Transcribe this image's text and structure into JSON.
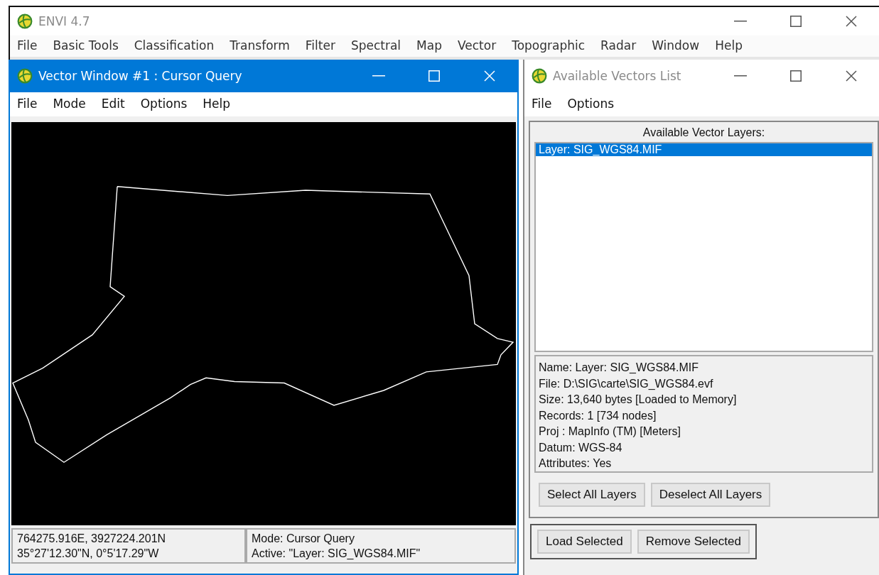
{
  "main_window": {
    "title": "ENVI 4.7",
    "active": false,
    "menu": [
      "File",
      "Basic Tools",
      "Classification",
      "Transform",
      "Filter",
      "Spectral",
      "Map",
      "Vector",
      "Topographic",
      "Radar",
      "Window",
      "Help"
    ]
  },
  "vector_window": {
    "title": "Vector Window #1 : Cursor Query",
    "active": true,
    "menu": [
      "File",
      "Mode",
      "Edit",
      "Options",
      "Help"
    ],
    "status": {
      "coordinates": [
        "764275.916E, 3927224.201N",
        "35°27'12.30\"N, 0°5'17.29\"W"
      ],
      "mode": [
        "Mode: Cursor Query",
        "Active: \"Layer: SIG_WGS84.MIF\""
      ]
    }
  },
  "vectors_list": {
    "title": "Available Vectors List",
    "active": false,
    "menu": [
      "File",
      "Options"
    ],
    "list_label": "Available Vector Layers:",
    "layers": [
      {
        "label": "Layer: SIG_WGS84.MIF",
        "selected": true
      }
    ],
    "info": [
      "Name: Layer: SIG_WGS84.MIF",
      "File: D:\\SIG\\carte\\SIG_WGS84.evf",
      "Size: 13,640 bytes [Loaded to Memory]",
      "Records: 1 [734 nodes]",
      "Proj : MapInfo (TM) [Meters]",
      "Datum: WGS-84",
      "Attributes: Yes"
    ],
    "layer_buttons": [
      "Select All Layers",
      "Deselect All Layers"
    ],
    "bottom_buttons": [
      "Load Selected",
      "Remove Selected"
    ]
  }
}
